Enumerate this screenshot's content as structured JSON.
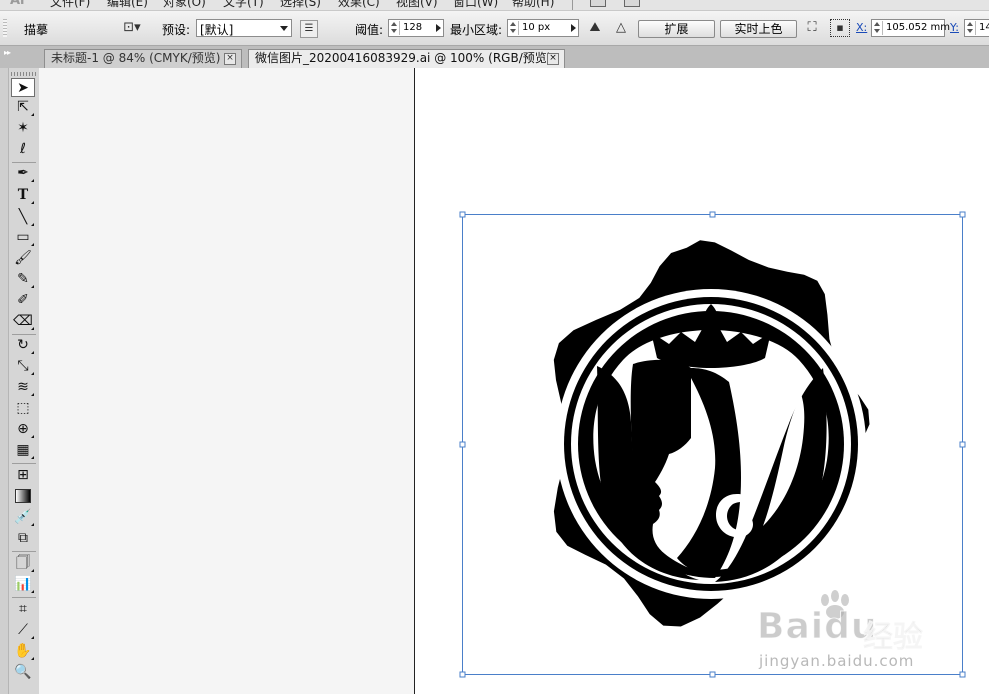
{
  "app": {
    "logo": "Ai"
  },
  "menu": {
    "items": [
      "文件(F)",
      "编辑(E)",
      "对象(O)",
      "文字(T)",
      "选择(S)",
      "效果(C)",
      "视图(V)",
      "窗口(W)",
      "帮助(H)"
    ]
  },
  "control_bar": {
    "mode_label": "描摹",
    "preset_label": "预设:",
    "preset_value": "[默认]",
    "threshold_label": "阈值:",
    "threshold_value": "128",
    "min_area_label": "最小区域:",
    "min_area_value": "10 px",
    "expand_label": "扩展",
    "live_paint_label": "实时上色",
    "x_label": "X:",
    "x_value": "105.052 mm",
    "y_label": "Y:",
    "y_value": "14"
  },
  "tabs": [
    {
      "label": "未标题-1 @ 84% (CMYK/预览)",
      "active": false
    },
    {
      "label": "微信图片_20200416083929.ai @ 100% (RGB/预览)",
      "active": true
    }
  ],
  "tools": [
    "selection-tool",
    "direct-selection-tool",
    "magic-wand-tool",
    "lasso-tool",
    "pen-tool",
    "type-tool",
    "line-segment-tool",
    "rectangle-tool",
    "paintbrush-tool",
    "pencil-tool",
    "blob-brush-tool",
    "eraser-tool",
    "rotate-tool",
    "scale-tool",
    "warp-tool",
    "free-transform-tool",
    "shape-builder-tool",
    "perspective-grid-tool",
    "mesh-tool",
    "gradient-tool",
    "eyedropper-tool",
    "blend-tool",
    "symbol-sprayer-tool",
    "column-graph-tool",
    "artboard-tool",
    "slice-tool",
    "hand-tool",
    "zoom-tool"
  ],
  "watermark": {
    "brand": "Baidu",
    "cn": "经验",
    "url": "jingyan.baidu.com"
  },
  "colors": {
    "selection": "#4a7fc9",
    "ink": "#000000",
    "paper": "#ffffff"
  }
}
